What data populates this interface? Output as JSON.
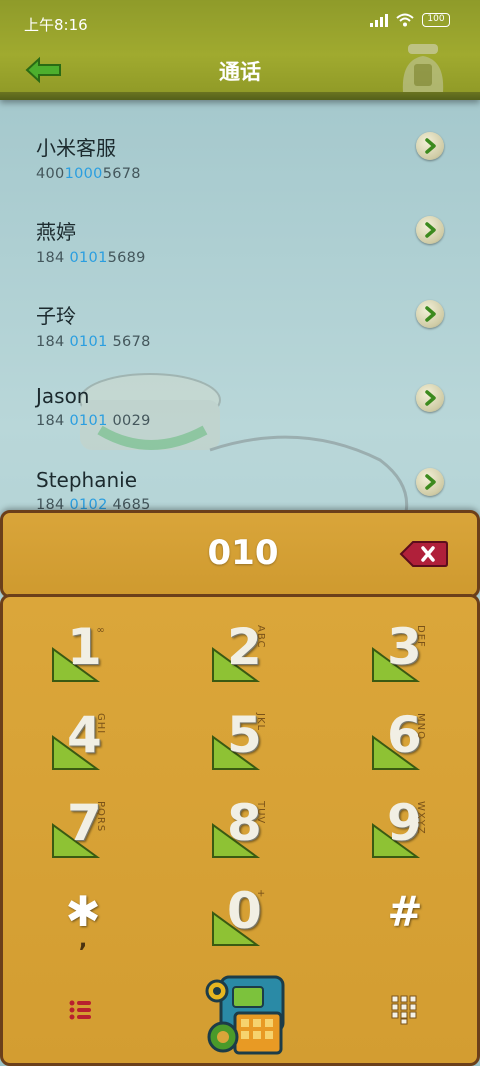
{
  "status_bar": {
    "time": "上午8:16",
    "battery": "100"
  },
  "header": {
    "title": "通话"
  },
  "contacts": [
    {
      "name": "小米客服",
      "number_pre": "400",
      "number_hl": "1000",
      "number_post": "5678"
    },
    {
      "name": "燕婷",
      "number_pre": "184 ",
      "number_hl": "0101",
      "number_post": "5689"
    },
    {
      "name": "子玲",
      "number_pre": "184 ",
      "number_hl": "0101",
      "number_post": " 5678"
    },
    {
      "name": "Jason",
      "number_pre": "184 ",
      "number_hl": "0101",
      "number_post": " 0029"
    },
    {
      "name": "Stephanie",
      "number_pre": "184 ",
      "number_hl": "0102",
      "number_post": " 4685"
    }
  ],
  "dialer": {
    "input": "010",
    "keys": [
      {
        "digit": "1",
        "letters": "∞"
      },
      {
        "digit": "2",
        "letters": "ABC"
      },
      {
        "digit": "3",
        "letters": "DEF"
      },
      {
        "digit": "4",
        "letters": "GHI"
      },
      {
        "digit": "5",
        "letters": "JKL"
      },
      {
        "digit": "6",
        "letters": "MNO"
      },
      {
        "digit": "7",
        "letters": "PQRS"
      },
      {
        "digit": "8",
        "letters": "TUV"
      },
      {
        "digit": "9",
        "letters": "WXYZ"
      },
      {
        "digit": "0",
        "letters": "+"
      }
    ],
    "star": "✱",
    "star_sub": ",",
    "hash": "#"
  },
  "colors": {
    "accent_blue": "#2a9ee0",
    "panel": "#d9a53a",
    "header": "#9aa42d"
  }
}
